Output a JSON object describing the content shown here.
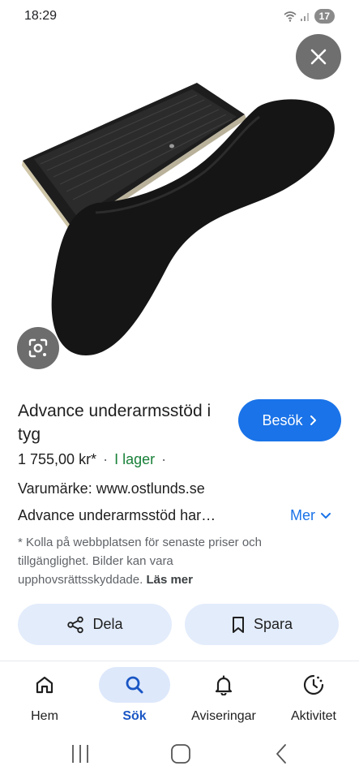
{
  "status_bar": {
    "time": "18:29",
    "battery": "17",
    "icons": [
      "wifi-icon",
      "signal-icon"
    ]
  },
  "product": {
    "title": "Advance underarmsstöd i tyg",
    "visit_label": "Besök",
    "price": "1 755,00 kr*",
    "stock": "I lager",
    "brand": "Varumärke: www.ostlunds.se",
    "description": "Advance underarmsstöd har…",
    "more_label": "Mer",
    "disclaimer": "* Kolla på webbplatsen för senaste priser och tillgänglighet. Bilder kan vara upphovsrättsskyddade.",
    "read_more": "Läs mer"
  },
  "actions": {
    "share_label": "Dela",
    "save_label": "Spara"
  },
  "bottom_nav": {
    "items": [
      {
        "label": "Hem",
        "icon": "home-icon"
      },
      {
        "label": "Sök",
        "icon": "search-icon",
        "active": true
      },
      {
        "label": "Aviseringar",
        "icon": "bell-icon"
      },
      {
        "label": "Aktivitet",
        "icon": "activity-icon"
      }
    ]
  },
  "colors": {
    "accent": "#1a73e8",
    "stock": "#188038",
    "chip_bg": "#e3ecfb"
  }
}
